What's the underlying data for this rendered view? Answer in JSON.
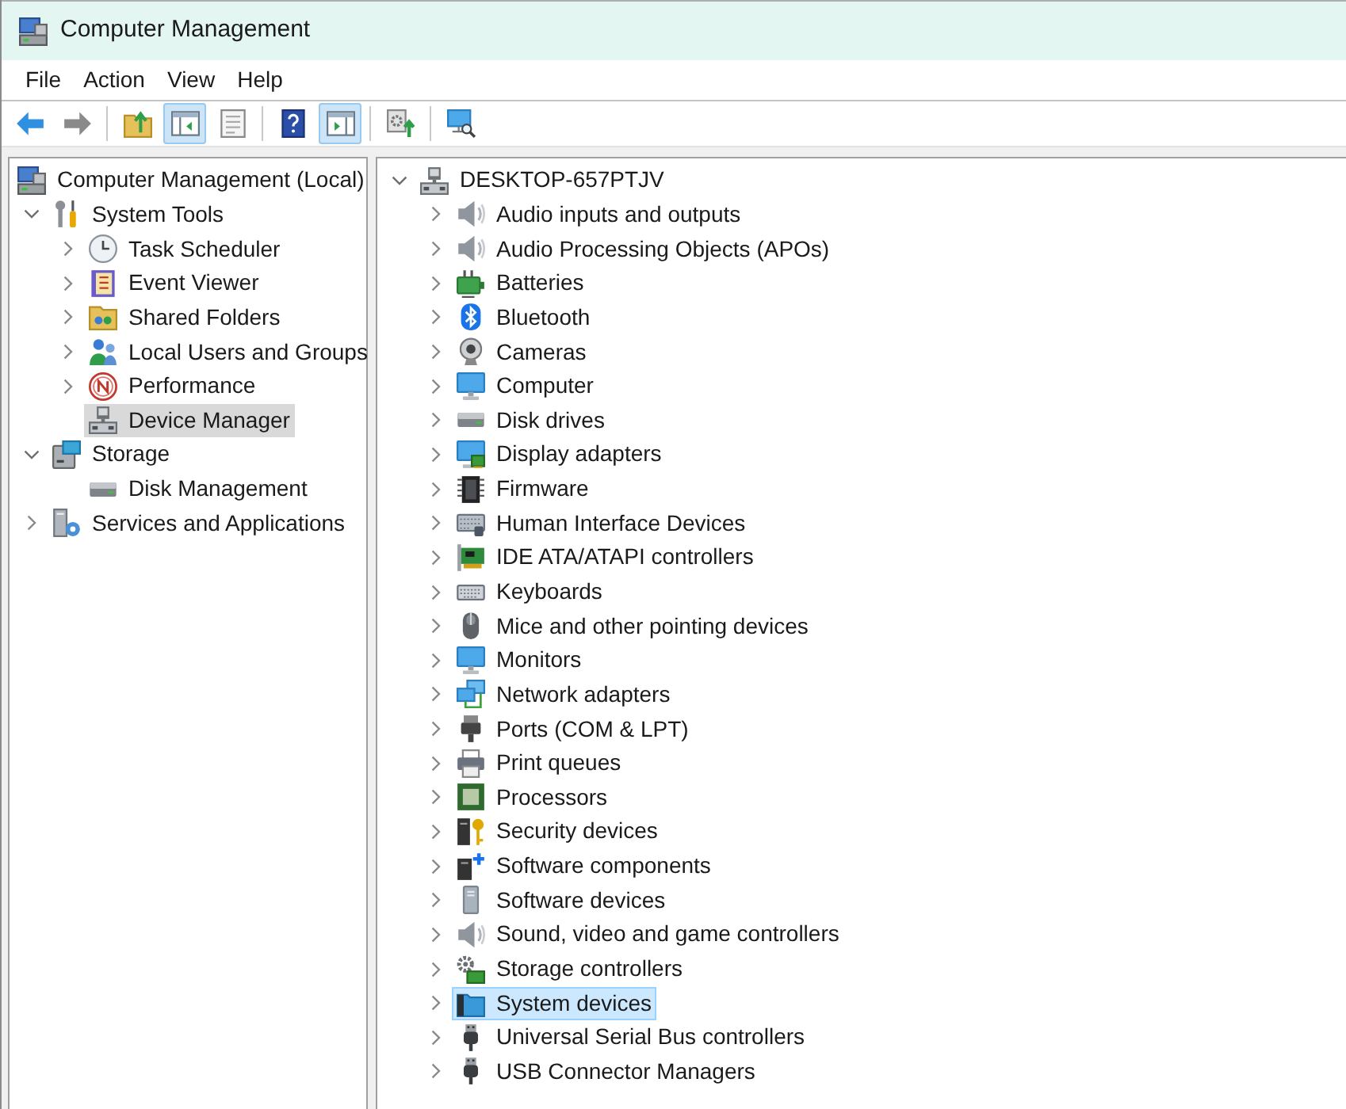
{
  "window": {
    "title": "Computer Management"
  },
  "menu": [
    {
      "label": "File"
    },
    {
      "label": "Action"
    },
    {
      "label": "View"
    },
    {
      "label": "Help"
    }
  ],
  "toolbar": [
    {
      "buttons": [
        {
          "kind": "back",
          "pressed": false,
          "disabled": false
        },
        {
          "kind": "forward",
          "pressed": false,
          "disabled": true
        }
      ]
    },
    {
      "buttons": [
        {
          "kind": "up",
          "pressed": false,
          "disabled": false
        },
        {
          "kind": "console_tree",
          "pressed": true,
          "disabled": false
        },
        {
          "kind": "properties",
          "pressed": false,
          "disabled": false
        }
      ]
    },
    {
      "buttons": [
        {
          "kind": "help",
          "pressed": false,
          "disabled": false
        },
        {
          "kind": "action_pane",
          "pressed": true,
          "disabled": false
        }
      ]
    },
    {
      "buttons": [
        {
          "kind": "export",
          "pressed": false,
          "disabled": false
        }
      ]
    },
    {
      "buttons": [
        {
          "kind": "scan",
          "pressed": false,
          "disabled": false
        }
      ]
    }
  ],
  "console_tree": {
    "focused": false,
    "root": {
      "label": "Computer Management (Local)",
      "kind": "computer_management",
      "selected": false,
      "children": [
        {
          "label": "System Tools",
          "kind": "system_tools",
          "expanded": true,
          "selected": false,
          "children": [
            {
              "label": "Task Scheduler",
              "kind": "task_scheduler",
              "expanded": false,
              "selected": false
            },
            {
              "label": "Event Viewer",
              "kind": "event_viewer",
              "expanded": false,
              "selected": false
            },
            {
              "label": "Shared Folders",
              "kind": "shared_folders",
              "expanded": false,
              "selected": false
            },
            {
              "label": "Local Users and Groups",
              "kind": "local_users",
              "expanded": false,
              "selected": false
            },
            {
              "label": "Performance",
              "kind": "performance",
              "expanded": false,
              "selected": false
            },
            {
              "label": "Device Manager",
              "kind": "device_manager",
              "selected": true
            }
          ]
        },
        {
          "label": "Storage",
          "kind": "storage",
          "expanded": true,
          "selected": false,
          "children": [
            {
              "label": "Disk Management",
              "kind": "disk_management",
              "selected": false
            }
          ]
        },
        {
          "label": "Services and Applications",
          "kind": "services",
          "expanded": false,
          "selected": false
        }
      ]
    }
  },
  "device_tree": {
    "focused": true,
    "root": {
      "label": "DESKTOP-657PTJV",
      "kind": "host",
      "expanded": true,
      "selected": false,
      "children": [
        {
          "label": "Audio inputs and outputs",
          "kind": "audio_io",
          "expanded": false,
          "selected": false
        },
        {
          "label": "Audio Processing Objects (APOs)",
          "kind": "apo",
          "expanded": false,
          "selected": false
        },
        {
          "label": "Batteries",
          "kind": "batteries",
          "expanded": false,
          "selected": false
        },
        {
          "label": "Bluetooth",
          "kind": "bluetooth",
          "expanded": false,
          "selected": false
        },
        {
          "label": "Cameras",
          "kind": "cameras",
          "expanded": false,
          "selected": false
        },
        {
          "label": "Computer",
          "kind": "computer",
          "expanded": false,
          "selected": false
        },
        {
          "label": "Disk drives",
          "kind": "disk_drives",
          "expanded": false,
          "selected": false
        },
        {
          "label": "Display adapters",
          "kind": "display_adapters",
          "expanded": false,
          "selected": false
        },
        {
          "label": "Firmware",
          "kind": "firmware",
          "expanded": false,
          "selected": false
        },
        {
          "label": "Human Interface Devices",
          "kind": "hid",
          "expanded": false,
          "selected": false
        },
        {
          "label": "IDE ATA/ATAPI controllers",
          "kind": "ide",
          "expanded": false,
          "selected": false
        },
        {
          "label": "Keyboards",
          "kind": "keyboards",
          "expanded": false,
          "selected": false
        },
        {
          "label": "Mice and other pointing devices",
          "kind": "mice",
          "expanded": false,
          "selected": false
        },
        {
          "label": "Monitors",
          "kind": "monitors",
          "expanded": false,
          "selected": false
        },
        {
          "label": "Network adapters",
          "kind": "network",
          "expanded": false,
          "selected": false
        },
        {
          "label": "Ports (COM & LPT)",
          "kind": "ports",
          "expanded": false,
          "selected": false
        },
        {
          "label": "Print queues",
          "kind": "print_queues",
          "expanded": false,
          "selected": false
        },
        {
          "label": "Processors",
          "kind": "processors",
          "expanded": false,
          "selected": false
        },
        {
          "label": "Security devices",
          "kind": "security",
          "expanded": false,
          "selected": false
        },
        {
          "label": "Software components",
          "kind": "software_components",
          "expanded": false,
          "selected": false
        },
        {
          "label": "Software devices",
          "kind": "software_devices",
          "expanded": false,
          "selected": false
        },
        {
          "label": "Sound, video and game controllers",
          "kind": "sound",
          "expanded": false,
          "selected": false
        },
        {
          "label": "Storage controllers",
          "kind": "storage_controllers",
          "expanded": false,
          "selected": false
        },
        {
          "label": "System devices",
          "kind": "system_devices",
          "expanded": false,
          "selected": true
        },
        {
          "label": "Universal Serial Bus controllers",
          "kind": "usb",
          "expanded": false,
          "selected": false
        },
        {
          "label": "USB Connector Managers",
          "kind": "usb_connector",
          "expanded": false,
          "selected": false
        }
      ]
    }
  }
}
